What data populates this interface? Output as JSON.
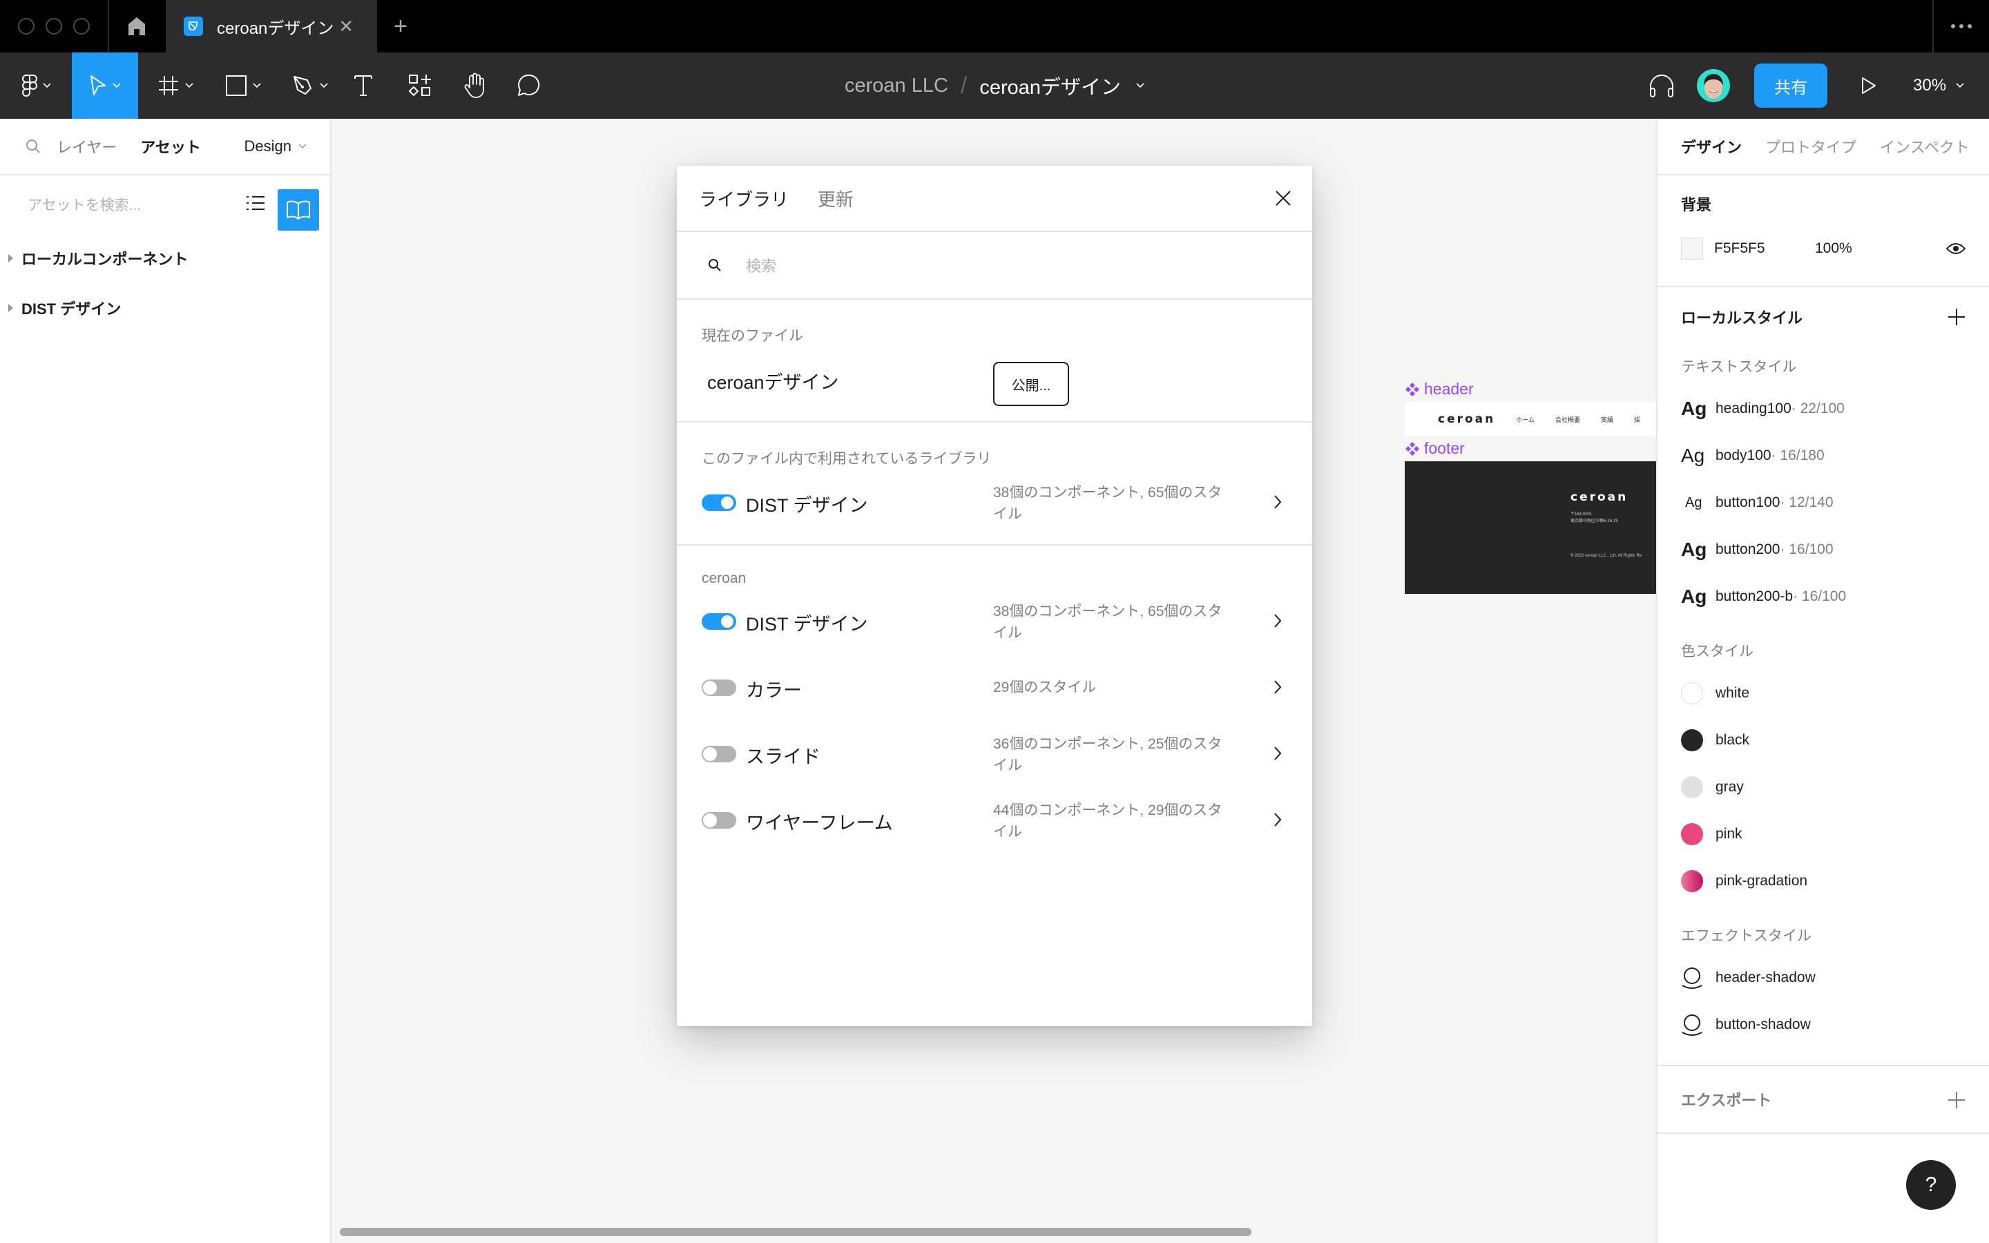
{
  "titlebar": {
    "tab_title": "ceroanデザイン",
    "tab_close": "✕",
    "new_tab": "+",
    "more": "more-icon"
  },
  "toolbar": {
    "tools": [
      "main-menu",
      "move",
      "frame",
      "rectangle",
      "pen",
      "text",
      "resources",
      "hand",
      "comment"
    ],
    "active_tool": "move",
    "team": "ceroan LLC",
    "separator": "/",
    "file_name": "ceroanデザイン",
    "share_label": "共有",
    "zoom": "30%",
    "accent_color": "#1E9BF8"
  },
  "left_panel": {
    "tabs": {
      "layers": "レイヤー",
      "assets": "アセット",
      "page": "Design"
    },
    "search_placeholder": "アセットを検索...",
    "groups": [
      {
        "label": "ローカルコンポーネント"
      },
      {
        "label": "DIST デザイン"
      }
    ]
  },
  "canvas": {
    "components": [
      {
        "label": "header",
        "logo": "ceroan",
        "nav": [
          "ホーム",
          "会社概要",
          "実績",
          "採"
        ]
      },
      {
        "label": "footer",
        "logo": "ceroan",
        "address": "〒164-0001\n東京都中野区中野5-26-29",
        "copyright": "© 2022 ceroan LLC., Ltd. All Rights Re"
      }
    ],
    "component_color": "#9747FF"
  },
  "modal": {
    "tabs": {
      "library": "ライブラリ",
      "updates": "更新"
    },
    "search_placeholder": "検索",
    "current_file": {
      "label": "現在のファイル",
      "name": "ceroanデザイン",
      "publish_label": "公開..."
    },
    "used_in_file": {
      "label": "このファイル内で利用されているライブラリ",
      "libraries": [
        {
          "name": "DIST デザイン",
          "enabled": true,
          "meta": "38個のコンポーネント, 65個のスタイル"
        }
      ]
    },
    "team": {
      "label": "ceroan",
      "libraries": [
        {
          "name": "DIST デザイン",
          "enabled": true,
          "meta": "38個のコンポーネント, 65個のスタイル"
        },
        {
          "name": "カラー",
          "enabled": false,
          "meta": "29個のスタイル"
        },
        {
          "name": "スライド",
          "enabled": false,
          "meta": "36個のコンポーネント, 25個のスタイル"
        },
        {
          "name": "ワイヤーフレーム",
          "enabled": false,
          "meta": "44個のコンポーネント, 29個のスタイル"
        }
      ]
    }
  },
  "right_panel": {
    "tabs": {
      "design": "デザイン",
      "prototype": "プロトタイプ",
      "inspect": "インスペクト"
    },
    "background": {
      "title": "背景",
      "hex": "F5F5F5",
      "opacity": "100%"
    },
    "local_styles": {
      "title": "ローカルスタイル",
      "text_styles_label": "テキストスタイル",
      "text_styles": [
        {
          "name": "heading100",
          "meta": " · 22/100",
          "weight": "bold"
        },
        {
          "name": "body100",
          "meta": " · 16/180",
          "weight": "regular"
        },
        {
          "name": "button100",
          "meta": " · 12/140",
          "weight": "small"
        },
        {
          "name": "button200",
          "meta": " · 16/100",
          "weight": "bold"
        },
        {
          "name": "button200-b",
          "meta": " · 16/100",
          "weight": "bold"
        }
      ],
      "color_styles_label": "色スタイル",
      "color_styles": [
        {
          "name": "white",
          "color": "#FFFFFF"
        },
        {
          "name": "black",
          "color": "#252525"
        },
        {
          "name": "gray",
          "color": "#E0E0E0"
        },
        {
          "name": "pink",
          "color": "#E9467C"
        },
        {
          "name": "pink-gradation",
          "color": "linear-gradient(90deg,#F07AA0,#C2105E)"
        }
      ],
      "effect_styles_label": "エフェクトスタイル",
      "effect_styles": [
        {
          "name": "header-shadow"
        },
        {
          "name": "button-shadow"
        }
      ]
    },
    "export": {
      "title": "エクスポート"
    }
  },
  "help": {
    "label": "?"
  }
}
